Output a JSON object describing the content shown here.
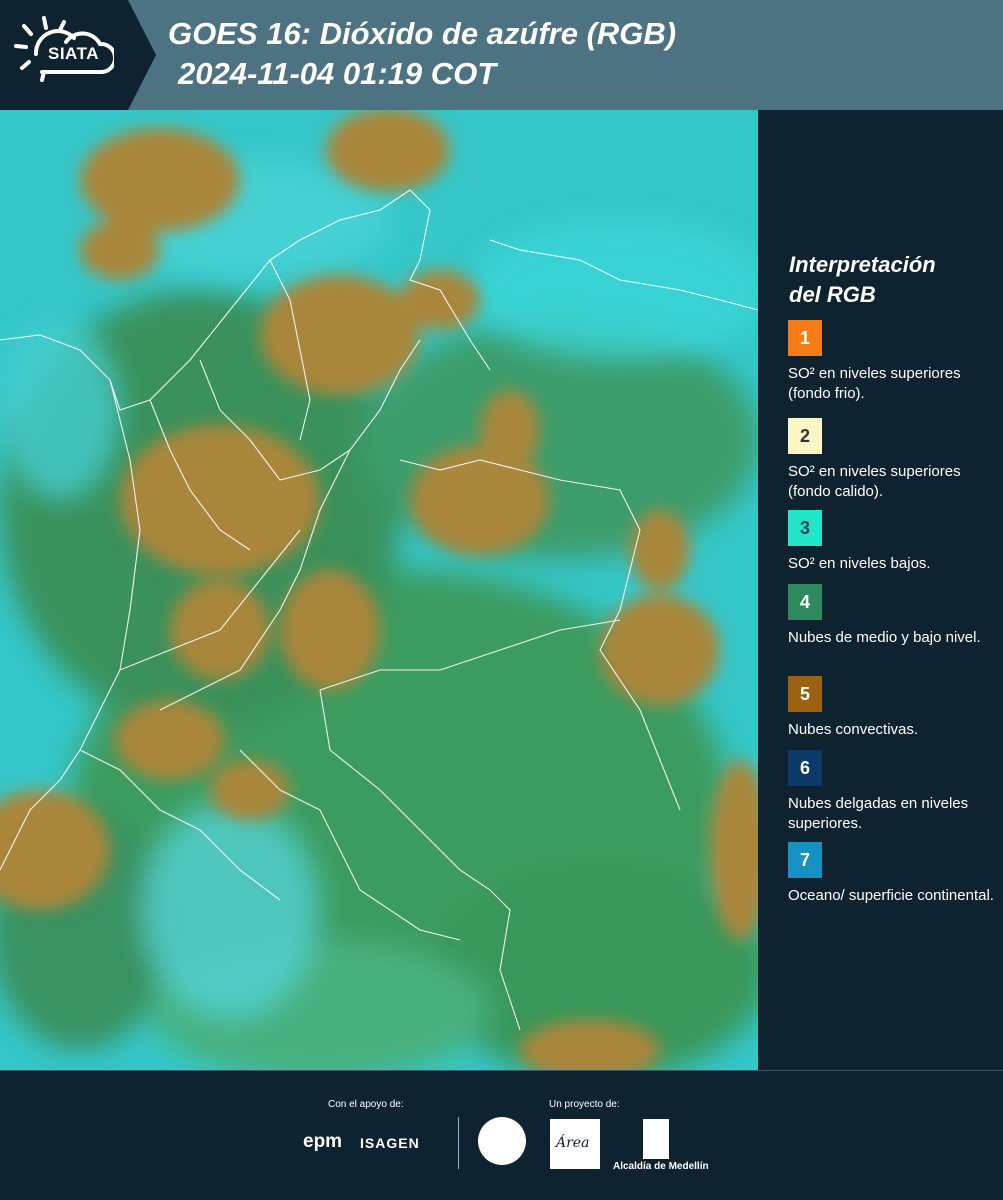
{
  "header": {
    "logo_text": "SIATA",
    "title_line1": "GOES 16: Dióxido de azúfre (RGB)",
    "title_line2": "2024-11-04 01:19 COT"
  },
  "legend": {
    "title_line1": "Interpretación",
    "title_line2": "del RGB",
    "items": [
      {
        "number": "1",
        "color": "#f47b16",
        "text_color": "#ffffff",
        "label": "SO² en niveles superiores (fondo frio)."
      },
      {
        "number": "2",
        "color": "#fdf6c4",
        "text_color": "#333333",
        "label": "SO² en niveles superiores (fondo calido)."
      },
      {
        "number": "3",
        "color": "#24e5c8",
        "text_color": "#134a52",
        "label": "SO² en niveles bajos."
      },
      {
        "number": "4",
        "color": "#2e8a5e",
        "text_color": "#ffffff",
        "label": "Nubes de medio y bajo nivel."
      },
      {
        "number": "5",
        "color": "#9a6210",
        "text_color": "#ffffff",
        "label": "Nubes convectivas."
      },
      {
        "number": "6",
        "color": "#0c3b6b",
        "text_color": "#ffffff",
        "label": "Nubes delgadas en niveles superiores."
      },
      {
        "number": "7",
        "color": "#1592c2",
        "text_color": "#ffffff",
        "label": "Oceano/ superficie continental."
      }
    ]
  },
  "footer": {
    "support_label": "Con el apoyo de:",
    "project_label": "Un proyecto de:",
    "epm": "epm",
    "isagen": "ISAGEN",
    "area": "Área",
    "alcaldia": "Alcaldía de Medellín"
  }
}
